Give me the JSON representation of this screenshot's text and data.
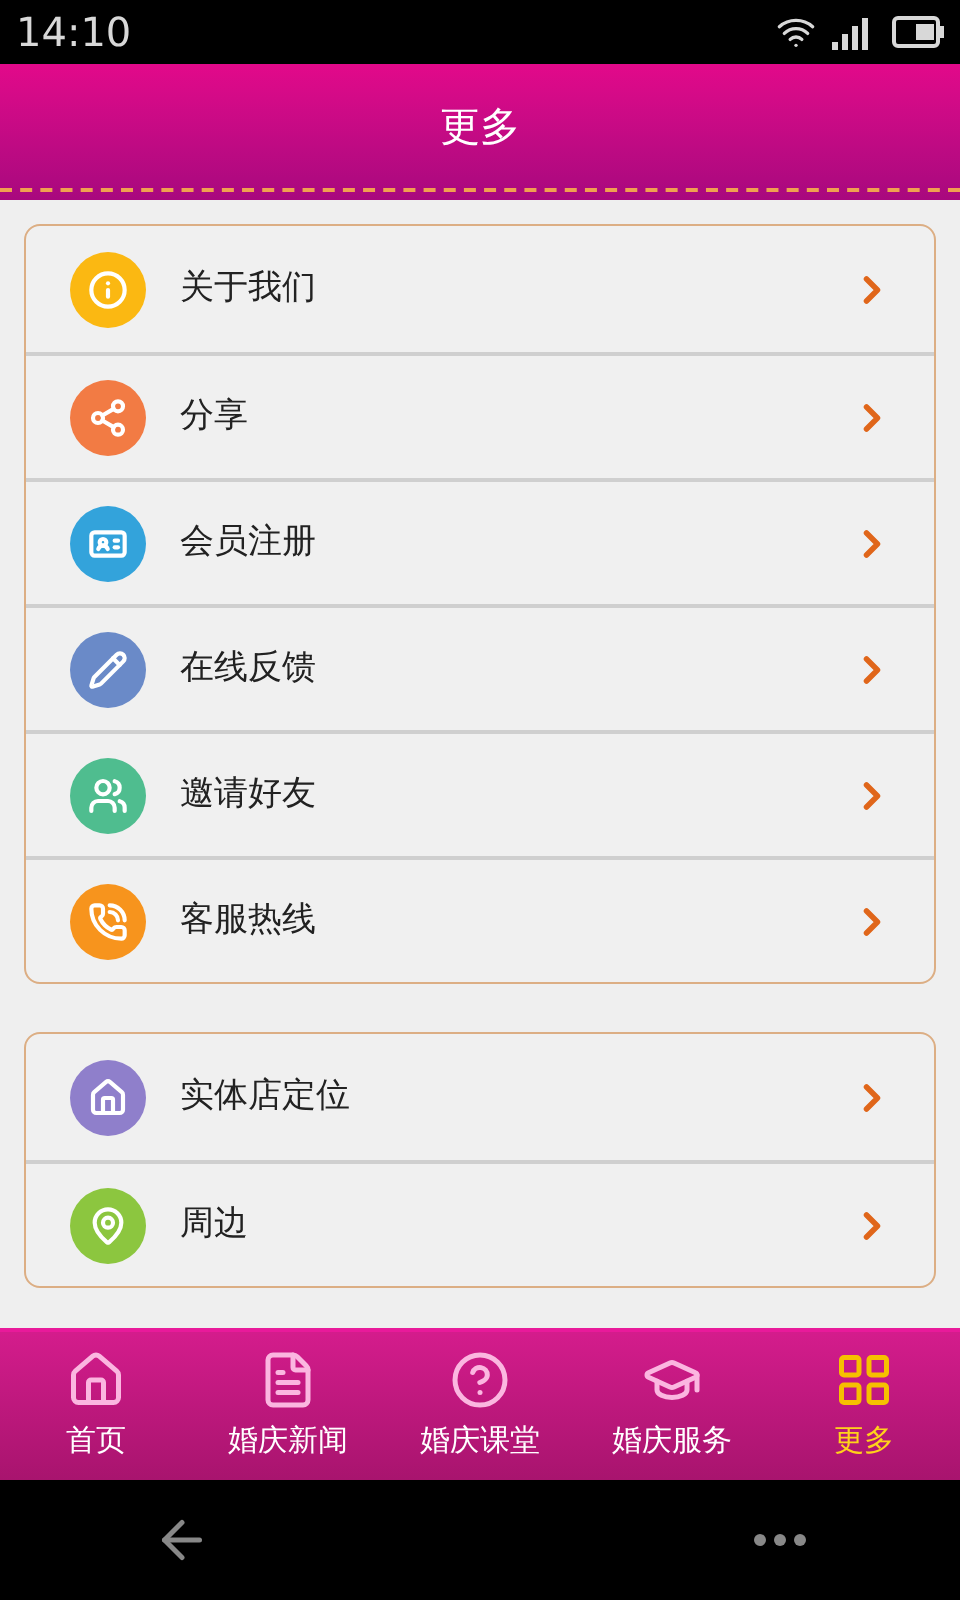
{
  "status_bar": {
    "time": "14:10"
  },
  "header": {
    "title": "更多"
  },
  "groups": [
    {
      "items": [
        {
          "label": "关于我们",
          "color": "#fbb812"
        },
        {
          "label": "分享",
          "color": "#f27b44"
        },
        {
          "label": "会员注册",
          "color": "#33a3db"
        },
        {
          "label": "在线反馈",
          "color": "#6a8ac8"
        },
        {
          "label": "邀请好友",
          "color": "#4fbd8f"
        },
        {
          "label": "客服热线",
          "color": "#f7941d"
        }
      ]
    },
    {
      "items": [
        {
          "label": "实体店定位",
          "color": "#8f7fcb"
        },
        {
          "label": "周边",
          "color": "#8cc63f"
        }
      ]
    }
  ],
  "tabs": [
    {
      "label": "首页",
      "selected": false
    },
    {
      "label": "婚庆新闻",
      "selected": false
    },
    {
      "label": "婚庆课堂",
      "selected": false
    },
    {
      "label": "婚庆服务",
      "selected": false
    },
    {
      "label": "更多",
      "selected": true
    }
  ]
}
